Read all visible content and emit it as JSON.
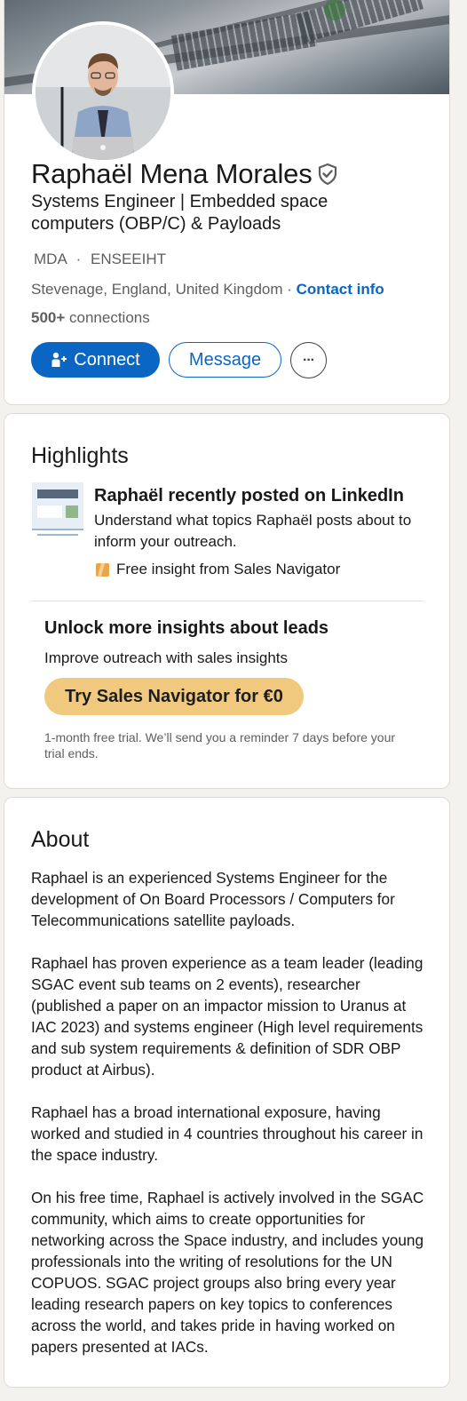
{
  "profile": {
    "name": "Raphaël Mena Morales",
    "headline": "Systems Engineer | Embedded space computers (OBP/C) & Payloads",
    "org_primary": "MDA",
    "org_separator": "·",
    "org_secondary": "ENSEEIHT",
    "location": "Stevenage, England, United Kingdom",
    "location_separator": " · ",
    "contact_info": "Contact info",
    "connections_count": "500+",
    "connections_label": " connections"
  },
  "actions": {
    "connect": "Connect",
    "message": "Message",
    "more": "···"
  },
  "highlights": {
    "title": "Highlights",
    "post_title": "Raphaël recently posted on LinkedIn",
    "post_desc": "Understand what topics Raphaël posts about to inform your outreach.",
    "insight": "Free insight from Sales Navigator",
    "unlock_title": "Unlock more insights about leads",
    "unlock_sub": "Improve outreach with sales insights",
    "cta": "Try Sales Navigator for €0",
    "trial_note": "1-month free trial. We’ll send you a reminder 7 days before your trial ends."
  },
  "about": {
    "title": "About",
    "paragraphs": [
      "Raphael is an experienced Systems Engineer for the development of On Board Processors / Computers for Telecommunications satellite payloads.",
      "Raphael has proven experience as a team leader (leading SGAC event sub teams on 2 events), researcher (published a paper on an impactor mission to Uranus at IAC 2023) and systems engineer (High level requirements and sub system requirements & definition of SDR OBP product at Airbus).",
      "Raphael has a broad international exposure, having worked and studied in 4 countries throughout his career in the space industry.",
      "On his free time, Raphael is actively involved in the SGAC community, which aims to create opportunities for networking across the Space industry, and includes young professionals into the writing of resolutions for the UN COPUOS. SGAC project groups also bring every year leading research papers on key topics to conferences across the world, and takes pride in having worked on papers presented at IACs."
    ]
  },
  "colors": {
    "linkedin_blue": "#0a66c2",
    "sales_nav_gold": "#f0c97f",
    "text_secondary": "#5e5e5e"
  },
  "icons": {
    "verified": "shield-check-icon",
    "connect": "add-person-icon",
    "more": "more-horizontal-icon",
    "post": "feed-post-icon",
    "sales_navigator": "sales-navigator-icon"
  }
}
